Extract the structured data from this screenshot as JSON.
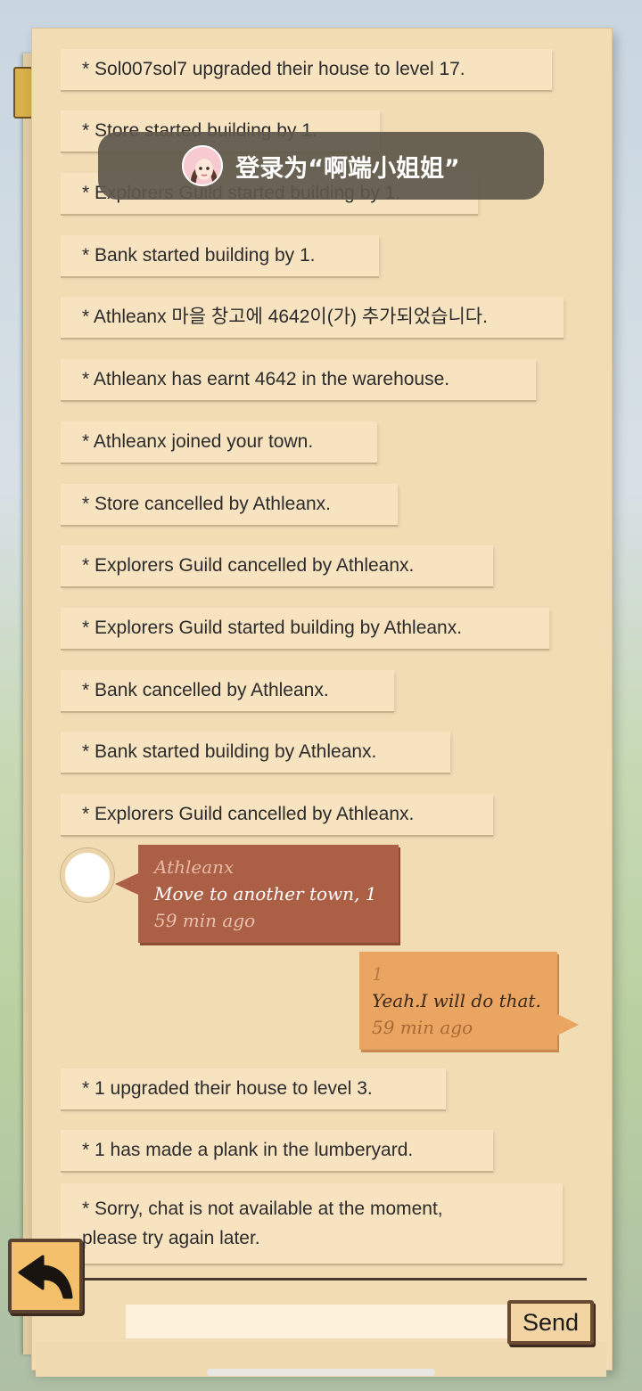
{
  "messages": [
    "* Sol007sol7 upgraded their house to level 17.",
    "* Store started building by 1.",
    "* Explorers Guild started building by 1.",
    "* Bank started building by 1.",
    "* Athleanx 마을 창고에 4642이(가) 추가되었습니다.",
    "* Athleanx has earnt 4642 in the warehouse.",
    "* Athleanx joined your town.",
    "* Store cancelled by Athleanx.",
    "* Explorers Guild cancelled by Athleanx.",
    "* Explorers Guild started building by Athleanx.",
    "* Bank cancelled by Athleanx.",
    "* Bank started building by Athleanx.",
    "* Explorers Guild cancelled by Athleanx."
  ],
  "toast": {
    "text": "登录为“啊端小姐姐”"
  },
  "chat": {
    "incoming": {
      "name": "Athleanx",
      "text": "Move to another town, 1",
      "time": "59 min ago"
    },
    "outgoing": {
      "name": "1",
      "text": "Yeah.I will do that.",
      "time": "59 min ago"
    }
  },
  "messages_after": [
    "* 1 upgraded their house to level 3.",
    "* 1 has made a plank in the lumberyard."
  ],
  "system_notice": {
    "line1": "* Sorry, chat is not available at the moment,",
    "line2": "please try again later."
  },
  "input": {
    "value": "",
    "placeholder": ""
  },
  "send_label": "Send",
  "icons": {
    "back": "back-arrow-icon",
    "avatar": "user-avatar-icon"
  },
  "colors": {
    "paper": "#f1dcb4",
    "incoming_bubble": "#ab5f45",
    "outgoing_bubble": "#eaa563"
  }
}
